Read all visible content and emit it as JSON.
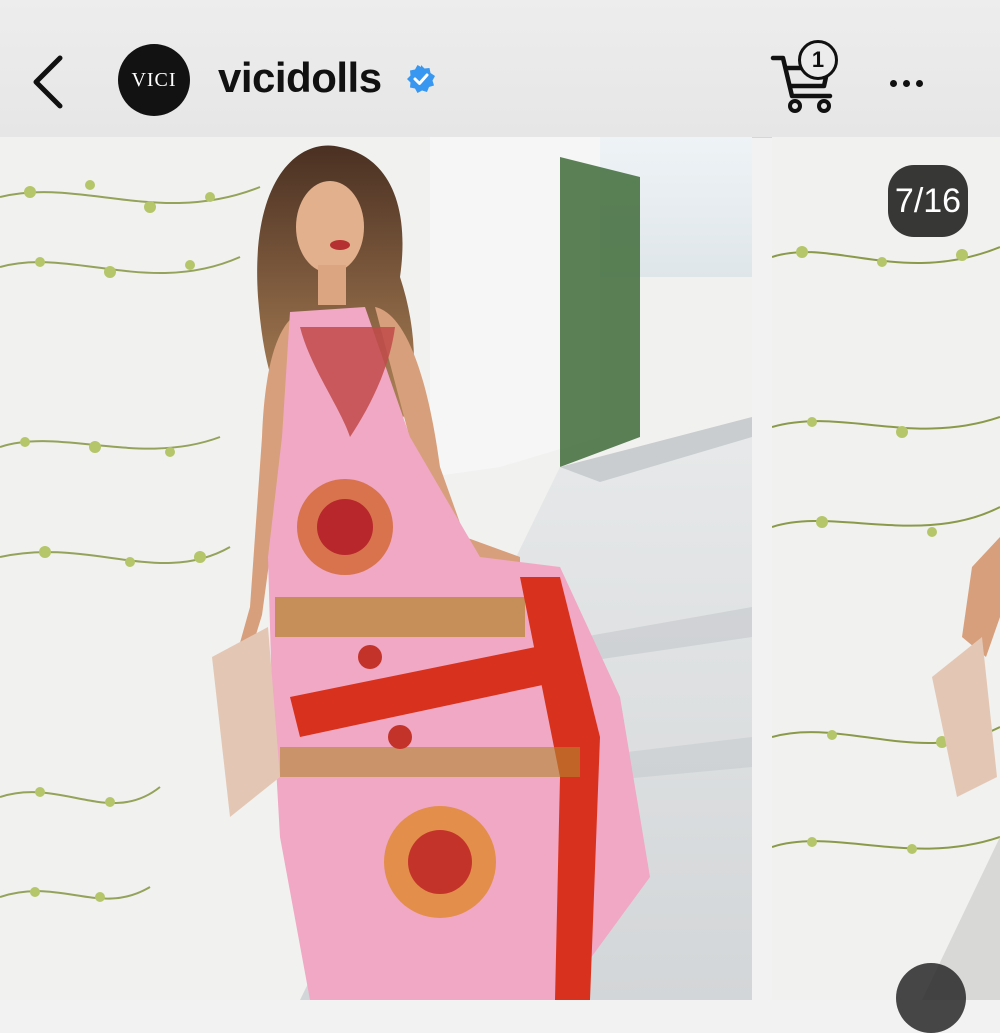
{
  "header": {
    "back_icon": "chevron-left-icon",
    "avatar_text": "VICI",
    "username": "vicidolls",
    "verified_icon": "verified-badge-icon",
    "verified_color": "#3897f0",
    "cart_icon": "shopping-cart-icon",
    "cart_count": "1",
    "more_icon": "more-horizontal-icon"
  },
  "carousel": {
    "counter": "7/16",
    "current_index": 7,
    "total": 16
  },
  "colors": {
    "header_bg": "#e9e9e9",
    "wall": "#f3f3f1",
    "dress_pink": "#f0a8c4",
    "dress_red": "#d8321e"
  }
}
